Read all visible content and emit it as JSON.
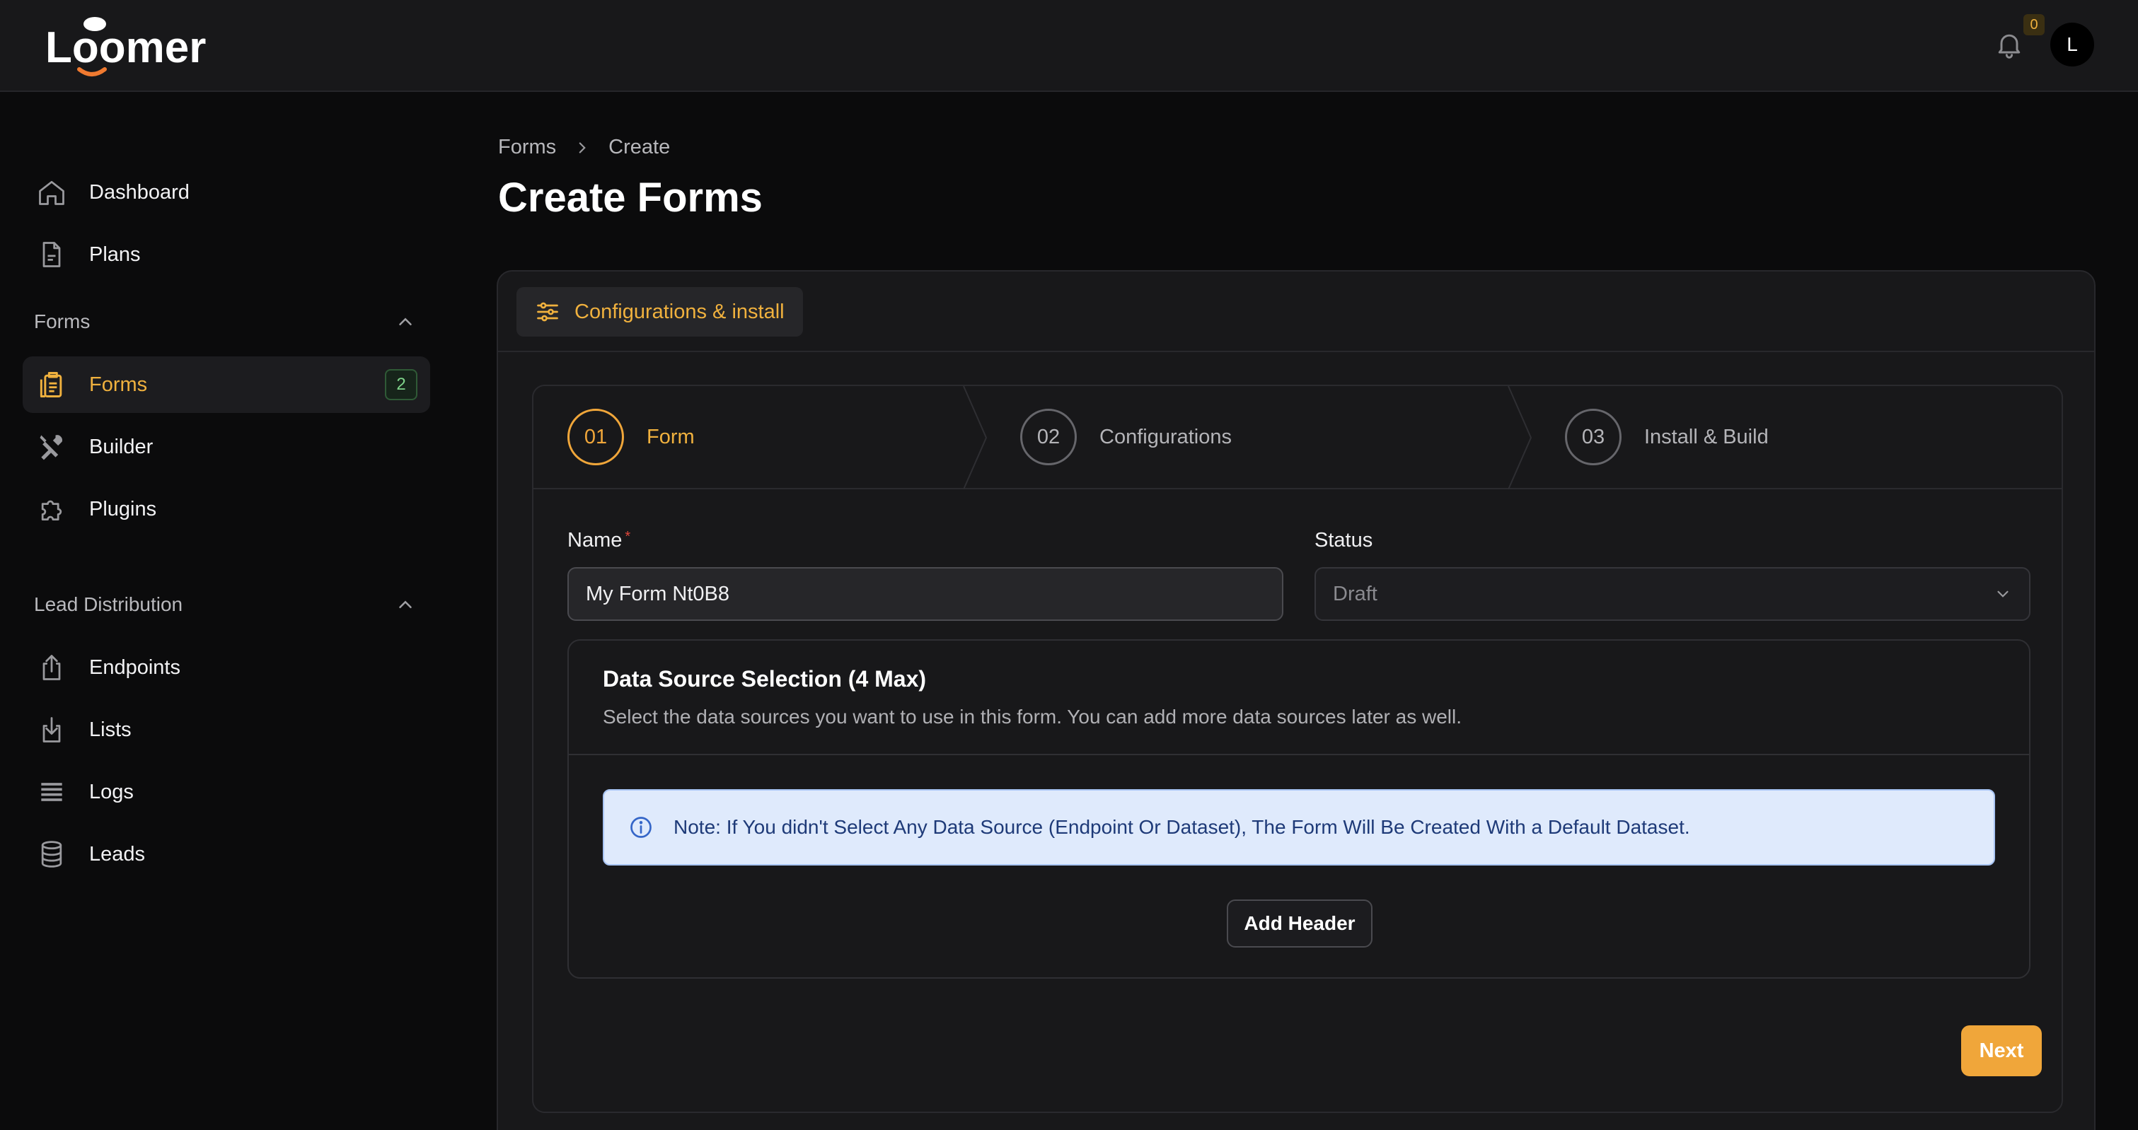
{
  "app": {
    "logo_text": "Loomer",
    "notification_count": "0",
    "avatar_initial": "L"
  },
  "sidebar": {
    "top_items": [
      {
        "label": "Dashboard",
        "icon": "home-icon"
      },
      {
        "label": "Plans",
        "icon": "document-icon"
      }
    ],
    "groups": [
      {
        "title": "Forms",
        "expanded": true,
        "items": [
          {
            "label": "Forms",
            "icon": "clipboard-icon",
            "active": true,
            "badge": "2"
          },
          {
            "label": "Builder",
            "icon": "tools-icon"
          },
          {
            "label": "Plugins",
            "icon": "puzzle-icon"
          }
        ]
      },
      {
        "title": "Lead Distribution",
        "expanded": true,
        "items": [
          {
            "label": "Endpoints",
            "icon": "upload-icon"
          },
          {
            "label": "Lists",
            "icon": "download-icon"
          },
          {
            "label": "Logs",
            "icon": "list-icon"
          },
          {
            "label": "Leads",
            "icon": "database-icon"
          }
        ]
      }
    ]
  },
  "breadcrumb": {
    "items": [
      "Forms",
      "Create"
    ]
  },
  "page": {
    "title": "Create Forms"
  },
  "card": {
    "tab_label": "Configurations & install",
    "steps": [
      {
        "number": "01",
        "label": "Form",
        "active": true
      },
      {
        "number": "02",
        "label": "Configurations",
        "active": false
      },
      {
        "number": "03",
        "label": "Install & Build",
        "active": false
      }
    ],
    "form": {
      "name_label": "Name",
      "name_required_mark": "*",
      "name_value": "My Form Nt0B8",
      "status_label": "Status",
      "status_value": "Draft"
    },
    "data_source": {
      "title": "Data Source Selection (4 Max)",
      "description": "Select the data sources you want to use in this form. You can add more data sources later as well.",
      "note": "Note: If You didn't Select Any Data Source (Endpoint Or Dataset), The Form Will Be Created With a Default Dataset.",
      "add_header_label": "Add Header"
    },
    "next_label": "Next"
  },
  "colors": {
    "accent": "#f0a63a",
    "background": "#0b0b0c",
    "panel": "#18181a",
    "note_bg": "#dfeafc"
  }
}
